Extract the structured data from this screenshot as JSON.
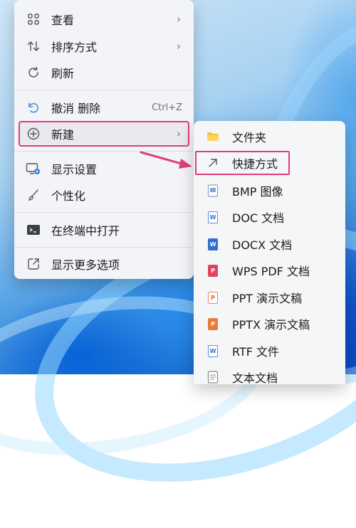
{
  "context_menu": {
    "items": [
      {
        "label": "查看",
        "icon": "grid-icon",
        "submenu": true
      },
      {
        "label": "排序方式",
        "icon": "sort-icon",
        "submenu": true
      },
      {
        "label": "刷新",
        "icon": "refresh-icon"
      },
      {
        "label": "撤消 删除",
        "icon": "undo-icon",
        "shortcut": "Ctrl+Z"
      },
      {
        "label": "新建",
        "icon": "plus-circle-icon",
        "submenu": true
      },
      {
        "label": "显示设置",
        "icon": "display-settings-icon"
      },
      {
        "label": "个性化",
        "icon": "brush-icon"
      },
      {
        "label": "在终端中打开",
        "icon": "terminal-icon"
      },
      {
        "label": "显示更多选项",
        "icon": "open-external-icon"
      }
    ]
  },
  "new_submenu": {
    "items": [
      {
        "label": "文件夹",
        "icon": "folder-icon"
      },
      {
        "label": "快捷方式",
        "icon": "shortcut-arrow-icon"
      },
      {
        "label": "BMP 图像",
        "icon": "bmp-image-icon"
      },
      {
        "label": "DOC 文档",
        "icon": "doc-icon"
      },
      {
        "label": "DOCX 文档",
        "icon": "docx-icon"
      },
      {
        "label": "WPS PDF 文档",
        "icon": "pdf-icon"
      },
      {
        "label": "PPT 演示文稿",
        "icon": "ppt-icon"
      },
      {
        "label": "PPTX 演示文稿",
        "icon": "pptx-icon"
      },
      {
        "label": "RTF 文件",
        "icon": "rtf-icon"
      },
      {
        "label": "文本文档",
        "icon": "txt-icon"
      }
    ]
  },
  "colors": {
    "highlight_border": "#e03b7c",
    "menu_background": "#f3f4f7"
  }
}
